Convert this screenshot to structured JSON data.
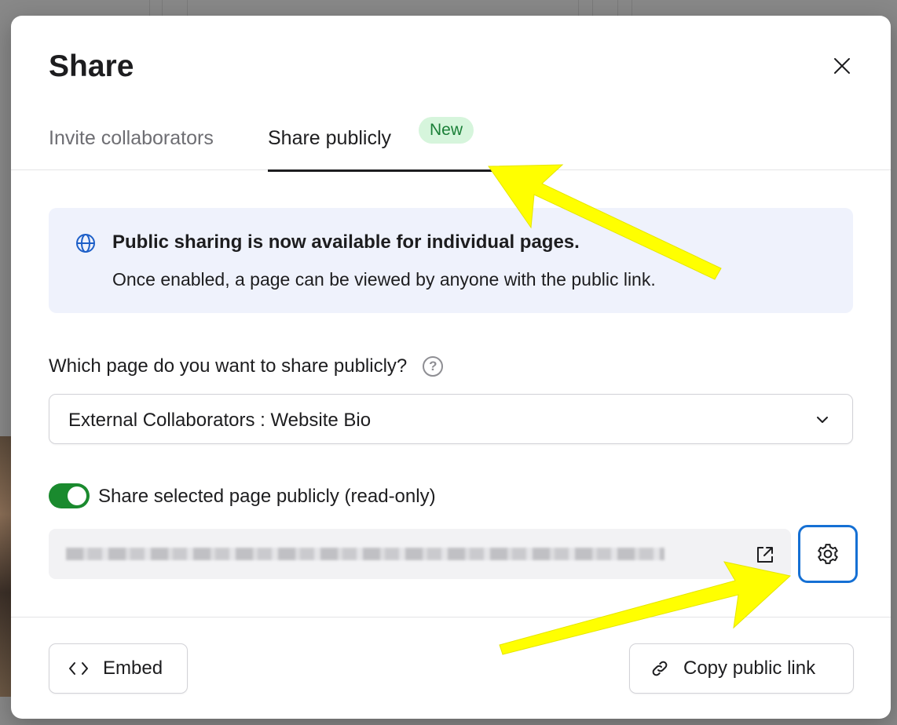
{
  "modal": {
    "title": "Share",
    "tabs": [
      {
        "label": "Invite collaborators",
        "active": false
      },
      {
        "label": "Share publicly",
        "active": true,
        "badge": "New"
      }
    ],
    "info": {
      "title": "Public sharing is now available for individual pages.",
      "body": "Once enabled, a page can be viewed by anyone with the public link."
    },
    "question": "Which page do you want to share publicly?",
    "page_select": {
      "value": "External Collaborators : Website Bio"
    },
    "toggle": {
      "label": "Share selected page publicly (read-only)",
      "enabled": true
    },
    "footer": {
      "embed_label": "Embed",
      "copy_label": "Copy public link"
    }
  },
  "colors": {
    "toggle_on": "#1a8a2e",
    "badge_bg": "#d6f5dc",
    "badge_text": "#1a7f37",
    "info_bg": "#eff2fc",
    "focus_ring": "#1570d4",
    "annotation_arrow": "#ffff00"
  },
  "icons": {
    "close": "close-icon",
    "globe": "globe-icon",
    "help": "help-icon",
    "chevron": "chevron-down-icon",
    "external": "external-link-icon",
    "settings": "gear-icon",
    "embed": "code-icon",
    "link": "link-icon"
  }
}
